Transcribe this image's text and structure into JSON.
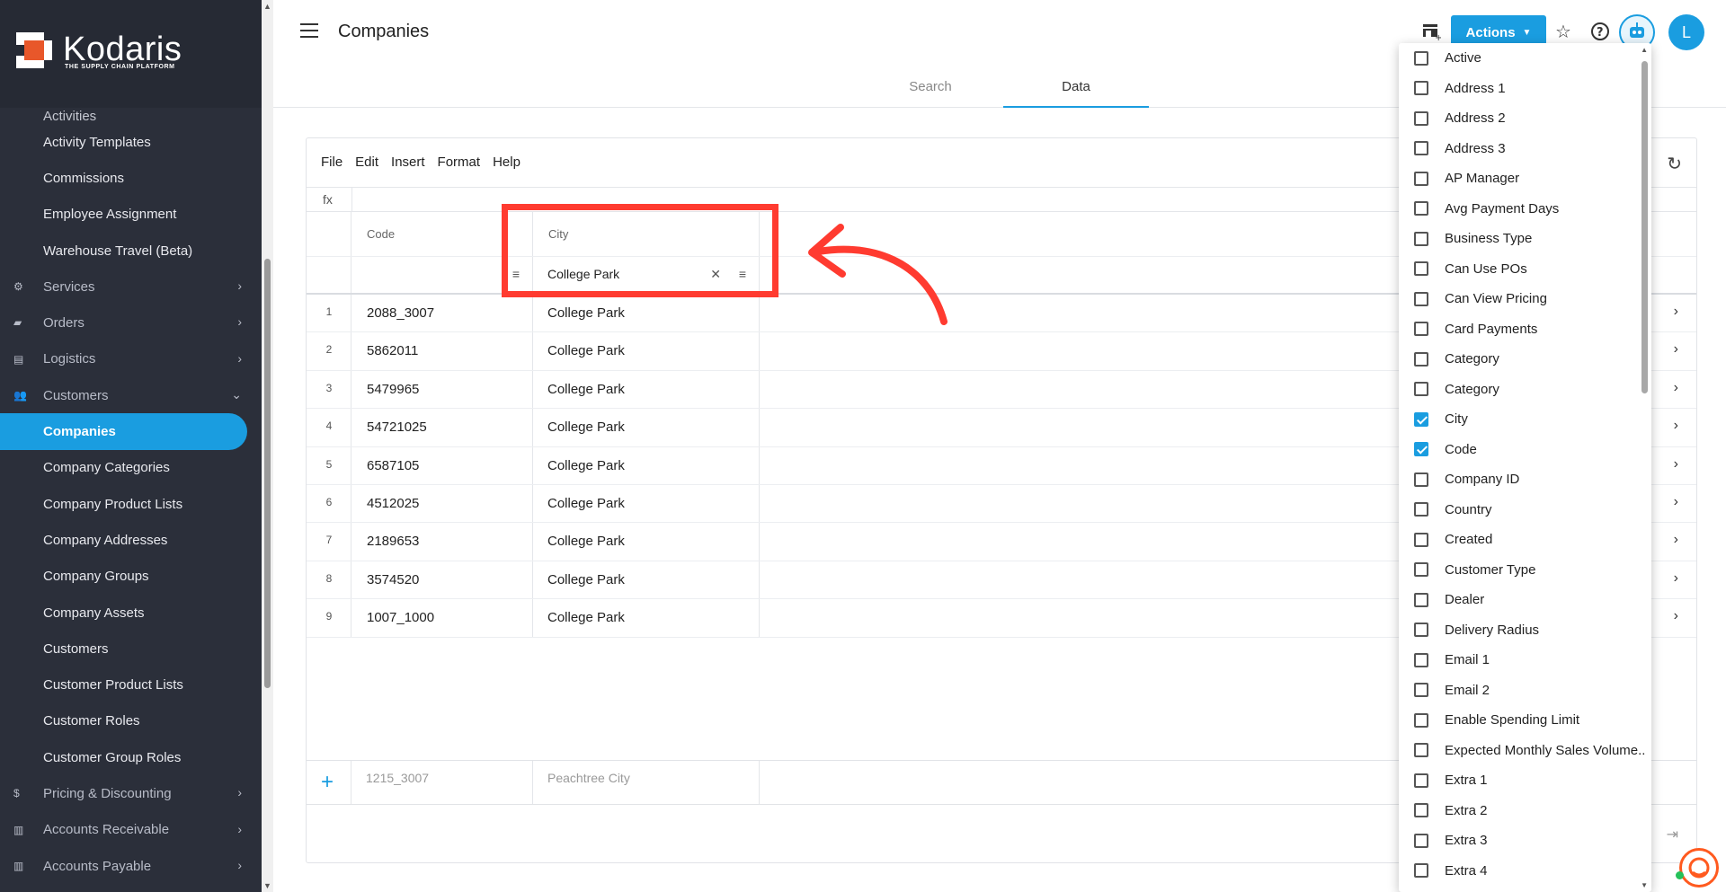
{
  "brand": {
    "name": "Kodaris",
    "tagline": "THE SUPPLY CHAIN PLATFORM"
  },
  "sidebar": {
    "clipped_item": "Activities",
    "items": [
      {
        "label": "Activity Templates",
        "kind": "sub"
      },
      {
        "label": "Commissions",
        "kind": "sub"
      },
      {
        "label": "Employee Assignment",
        "kind": "sub"
      },
      {
        "label": "Warehouse Travel (Beta)",
        "kind": "sub"
      },
      {
        "label": "Services",
        "kind": "top",
        "icon": "gears-icon"
      },
      {
        "label": "Orders",
        "kind": "top",
        "icon": "truck-icon"
      },
      {
        "label": "Logistics",
        "kind": "top",
        "icon": "delivery-icon"
      },
      {
        "label": "Customers",
        "kind": "top",
        "icon": "people-icon",
        "expanded": true
      },
      {
        "label": "Companies",
        "kind": "sub",
        "active": true
      },
      {
        "label": "Company Categories",
        "kind": "sub"
      },
      {
        "label": "Company Product Lists",
        "kind": "sub"
      },
      {
        "label": "Company Addresses",
        "kind": "sub"
      },
      {
        "label": "Company Groups",
        "kind": "sub"
      },
      {
        "label": "Company Assets",
        "kind": "sub"
      },
      {
        "label": "Customers",
        "kind": "sub"
      },
      {
        "label": "Customer Product Lists",
        "kind": "sub"
      },
      {
        "label": "Customer Roles",
        "kind": "sub"
      },
      {
        "label": "Customer Group Roles",
        "kind": "sub"
      },
      {
        "label": "Pricing & Discounting",
        "kind": "top",
        "icon": "dollar-icon"
      },
      {
        "label": "Accounts Receivable",
        "kind": "top",
        "icon": "bank-icon"
      },
      {
        "label": "Accounts Payable",
        "kind": "top",
        "icon": "bank-icon"
      }
    ]
  },
  "header": {
    "title": "Companies",
    "tabs": [
      {
        "label": "Search"
      },
      {
        "label": "Data",
        "active": true
      }
    ],
    "actions_label": "Actions",
    "avatar_initial": "L"
  },
  "menubar": [
    "File",
    "Edit",
    "Insert",
    "Format",
    "Help"
  ],
  "formula_label": "fx",
  "grid": {
    "columns": {
      "code": "Code",
      "city": "City"
    },
    "city_filter": "College Park",
    "rows": [
      {
        "idx": "1",
        "code": "2088_3007",
        "city": "College Park"
      },
      {
        "idx": "2",
        "code": "5862011",
        "city": "College Park"
      },
      {
        "idx": "3",
        "code": "5479965",
        "city": "College Park"
      },
      {
        "idx": "4",
        "code": "54721025",
        "city": "College Park"
      },
      {
        "idx": "5",
        "code": "6587105",
        "city": "College Park"
      },
      {
        "idx": "6",
        "code": "4512025",
        "city": "College Park"
      },
      {
        "idx": "7",
        "code": "2189653",
        "city": "College Park"
      },
      {
        "idx": "8",
        "code": "3574520",
        "city": "College Park"
      },
      {
        "idx": "9",
        "code": "1007_1000",
        "city": "College Park"
      }
    ],
    "new_row": {
      "code": "1215_3007",
      "city": "Peachtree City"
    }
  },
  "column_chooser": [
    {
      "label": "Active",
      "checked": false
    },
    {
      "label": "Address 1",
      "checked": false
    },
    {
      "label": "Address 2",
      "checked": false
    },
    {
      "label": "Address 3",
      "checked": false
    },
    {
      "label": "AP Manager",
      "checked": false
    },
    {
      "label": "Avg Payment Days",
      "checked": false
    },
    {
      "label": "Business Type",
      "checked": false
    },
    {
      "label": "Can Use POs",
      "checked": false
    },
    {
      "label": "Can View Pricing",
      "checked": false
    },
    {
      "label": "Card Payments",
      "checked": false
    },
    {
      "label": "Category",
      "checked": false
    },
    {
      "label": "Category",
      "checked": false
    },
    {
      "label": "City",
      "checked": true
    },
    {
      "label": "Code",
      "checked": true
    },
    {
      "label": "Company ID",
      "checked": false
    },
    {
      "label": "Country",
      "checked": false
    },
    {
      "label": "Created",
      "checked": false
    },
    {
      "label": "Customer Type",
      "checked": false
    },
    {
      "label": "Dealer",
      "checked": false
    },
    {
      "label": "Delivery Radius",
      "checked": false
    },
    {
      "label": "Email 1",
      "checked": false
    },
    {
      "label": "Email 2",
      "checked": false
    },
    {
      "label": "Enable Spending Limit",
      "checked": false
    },
    {
      "label": "Expected Monthly Sales Volume..",
      "checked": false
    },
    {
      "label": "Extra 1",
      "checked": false
    },
    {
      "label": "Extra 2",
      "checked": false
    },
    {
      "label": "Extra 3",
      "checked": false
    },
    {
      "label": "Extra 4",
      "checked": false
    }
  ],
  "colors": {
    "accent": "#1a9de0",
    "sidebar": "#2b2f3a",
    "annotation": "#ff3b30"
  }
}
